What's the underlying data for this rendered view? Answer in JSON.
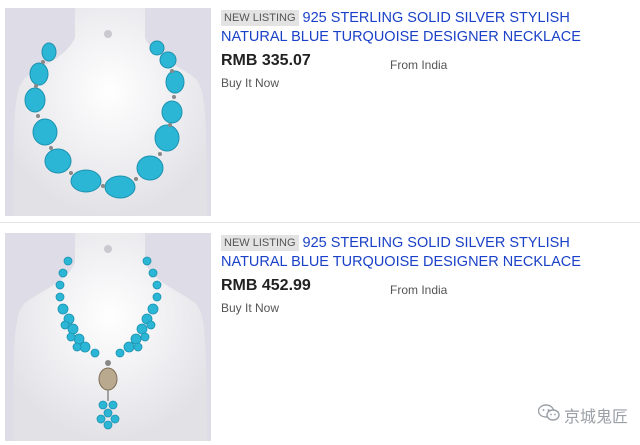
{
  "listings": [
    {
      "badge": "NEW LISTING",
      "title": "925 STERLING SOLID SILVER STYLISH NATURAL BLUE TURQUOISE DESIGNER NECKLACE",
      "price": "RMB 335.07",
      "origin": "From India",
      "format": "Buy It Now",
      "image_icon": "turquoise-oval-bead-necklace"
    },
    {
      "badge": "NEW LISTING",
      "title": "925 STERLING SOLID SILVER STYLISH NATURAL BLUE TURQUOISE DESIGNER NECKLACE",
      "price": "RMB 452.99",
      "origin": "From India",
      "format": "Buy It Now",
      "image_icon": "turquoise-cluster-pendant-necklace"
    }
  ],
  "watermark": {
    "text": "京城鬼匠",
    "icon": "wechat-icon"
  },
  "colors": {
    "link": "#1a41c8",
    "badge_bg": "#e3e3e3",
    "turquoise": "#2cb6d6",
    "photo_bg": "#dedce6"
  }
}
